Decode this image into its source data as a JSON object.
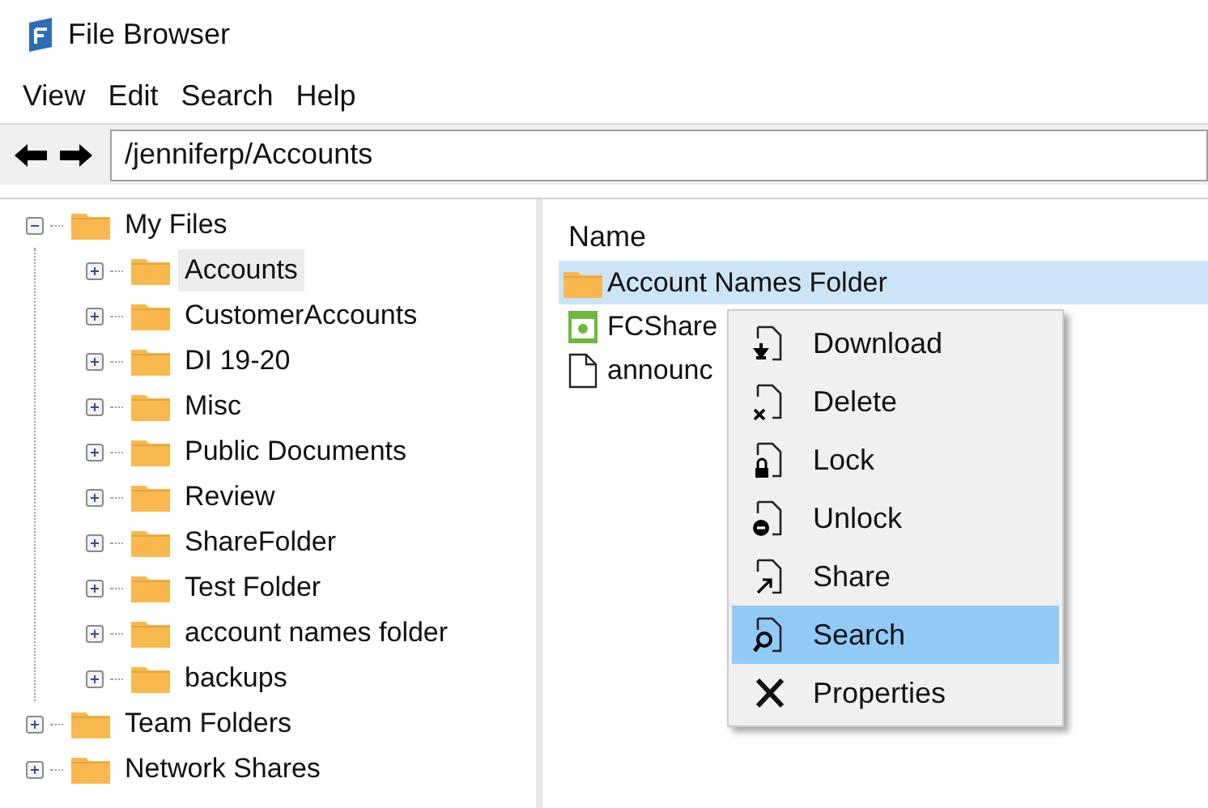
{
  "window": {
    "title": "File Browser"
  },
  "menu": [
    "View",
    "Edit",
    "Search",
    "Help"
  ],
  "address": {
    "value": "/jenniferp/Accounts"
  },
  "tree": [
    {
      "label": "My Files",
      "expanded": true,
      "selected": false,
      "children": [
        {
          "label": "Accounts",
          "expanded": false,
          "selected": true
        },
        {
          "label": "CustomerAccounts",
          "expanded": false,
          "selected": false
        },
        {
          "label": "DI 19-20",
          "expanded": false,
          "selected": false
        },
        {
          "label": "Misc",
          "expanded": false,
          "selected": false
        },
        {
          "label": "Public Documents",
          "expanded": false,
          "selected": false
        },
        {
          "label": "Review",
          "expanded": false,
          "selected": false
        },
        {
          "label": "ShareFolder",
          "expanded": false,
          "selected": false
        },
        {
          "label": "Test Folder",
          "expanded": false,
          "selected": false
        },
        {
          "label": "account names folder",
          "expanded": false,
          "selected": false
        },
        {
          "label": "backups",
          "expanded": false,
          "selected": false
        }
      ]
    },
    {
      "label": "Team Folders",
      "expanded": false,
      "selected": false
    },
    {
      "label": "Network Shares",
      "expanded": false,
      "selected": false
    }
  ],
  "file_list": {
    "columns": [
      "Name"
    ],
    "rows": [
      {
        "name": "Account Names Folder",
        "kind": "folder",
        "selected": true
      },
      {
        "name": "FCShare",
        "kind": "image",
        "selected": false
      },
      {
        "name": "announc",
        "kind": "document",
        "selected": false
      }
    ]
  },
  "context_menu": [
    {
      "label": "Download",
      "kind": "download",
      "selected": false
    },
    {
      "label": "Delete",
      "kind": "delete",
      "selected": false
    },
    {
      "label": "Lock",
      "kind": "lock",
      "selected": false
    },
    {
      "label": "Unlock",
      "kind": "unlock",
      "selected": false
    },
    {
      "label": "Share",
      "kind": "share",
      "selected": false
    },
    {
      "label": "Search",
      "kind": "search",
      "selected": true
    },
    {
      "label": "Properties",
      "kind": "properties",
      "selected": false
    }
  ]
}
